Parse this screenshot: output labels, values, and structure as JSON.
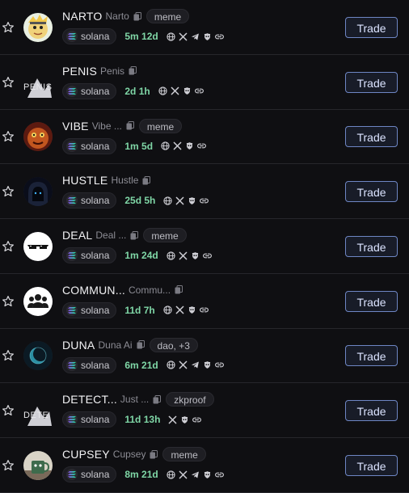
{
  "trade_label": "Trade",
  "tokens": [
    {
      "symbol": "NARTO",
      "name": "Narto",
      "tag": "meme",
      "chain": "solana",
      "age": "5m 12d",
      "avatar": "pepe-cartoon",
      "links": [
        "globe-icon",
        "x-icon",
        "telegram-icon",
        "dex-icon",
        "link-icon"
      ]
    },
    {
      "symbol": "PENIS",
      "name": "Penis",
      "tag": "",
      "chain": "solana",
      "age": "2d 1h",
      "avatar_alt": "PENIS",
      "links": [
        "globe-icon",
        "x-icon",
        "dex-icon",
        "link-icon"
      ]
    },
    {
      "symbol": "VIBE",
      "name": "Vibe ...",
      "tag": "meme",
      "chain": "solana",
      "age": "1m 5d",
      "avatar": "orange-creature",
      "links": [
        "globe-icon",
        "x-icon",
        "dex-icon",
        "link-icon"
      ]
    },
    {
      "symbol": "HUSTLE",
      "name": "Hustle",
      "tag": "",
      "chain": "solana",
      "age": "25d 5h",
      "avatar": "hooded-figure",
      "links": [
        "globe-icon",
        "x-icon",
        "dex-icon",
        "link-icon"
      ]
    },
    {
      "symbol": "DEAL",
      "name": "Deal ...",
      "tag": "meme",
      "chain": "solana",
      "age": "1m 24d",
      "avatar": "sunglasses",
      "links": [
        "globe-icon",
        "x-icon",
        "dex-icon",
        "link-icon"
      ]
    },
    {
      "symbol": "COMMUN...",
      "name": "Commu...",
      "tag": "",
      "chain": "solana",
      "age": "11d 7h",
      "avatar": "community-people",
      "links": [
        "globe-icon",
        "x-icon",
        "dex-icon",
        "link-icon"
      ]
    },
    {
      "symbol": "DUNA",
      "name": "Duna Ai",
      "tag": "dao, +3",
      "chain": "solana",
      "age": "6m 21d",
      "avatar": "teal-planet",
      "links": [
        "globe-icon",
        "x-icon",
        "telegram-icon",
        "dex-icon",
        "link-icon"
      ]
    },
    {
      "symbol": "DETECT...",
      "name": "Just ...",
      "tag": "zkproof",
      "chain": "solana",
      "age": "11d 13h",
      "avatar_alt": "DETE",
      "links": [
        "x-icon",
        "dex-icon",
        "link-icon"
      ]
    },
    {
      "symbol": "CUPSEY",
      "name": "Cupsey",
      "tag": "meme",
      "chain": "solana",
      "age": "8m 21d",
      "avatar": "cup-character",
      "links": [
        "globe-icon",
        "x-icon",
        "telegram-icon",
        "dex-icon",
        "link-icon"
      ]
    }
  ]
}
